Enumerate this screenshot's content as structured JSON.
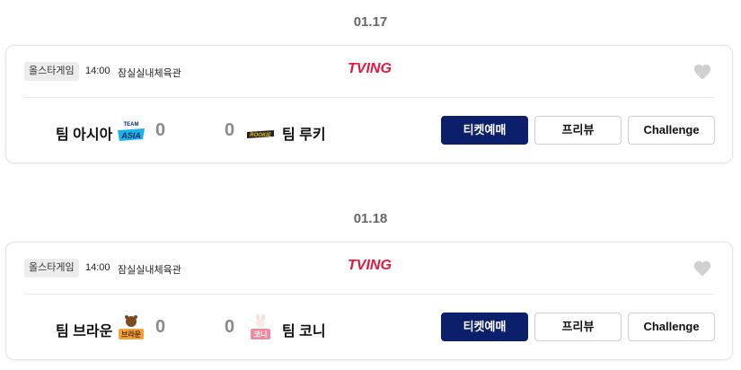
{
  "games": [
    {
      "date": "01.17",
      "game_type": "올스타게임",
      "time": "14:00",
      "venue": "잠실실내체육관",
      "broadcaster": "TVING",
      "home_team": "팀 아시아",
      "home_logo_text": "ASIA",
      "home_score": "0",
      "away_score": "0",
      "away_logo_text": "ROOKIE",
      "away_team": "팀 루키",
      "buttons": {
        "ticket": "티켓예매",
        "preview": "프리뷰",
        "challenge": "Challenge"
      }
    },
    {
      "date": "01.18",
      "game_type": "올스타게임",
      "time": "14:00",
      "venue": "잠실실내체육관",
      "broadcaster": "TVING",
      "home_team": "팀 브라운",
      "home_logo_text": "브라운",
      "home_score": "0",
      "away_score": "0",
      "away_logo_text": "코니",
      "away_team": "팀 코니",
      "buttons": {
        "ticket": "티켓예매",
        "preview": "프리뷰",
        "challenge": "Challenge"
      }
    }
  ],
  "colors": {
    "primary_button": "#0c1f6b",
    "broadcaster": "#e5173f",
    "heart": "#d0d0d0",
    "score": "#8a8a8a"
  }
}
